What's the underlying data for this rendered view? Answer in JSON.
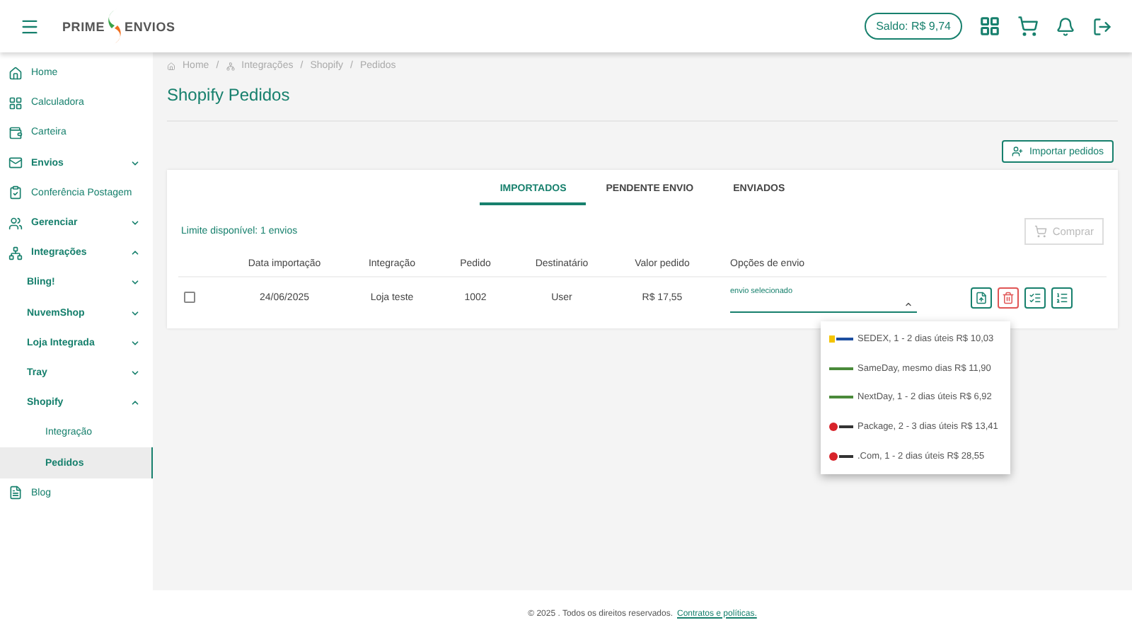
{
  "header": {
    "logo_left": "PRIME",
    "logo_right": "ENVIOS",
    "balance": "Saldo: R$ 9,74"
  },
  "sidebar": {
    "items": [
      {
        "label": "Home",
        "selected": false
      },
      {
        "label": "Calculadora",
        "selected": false
      },
      {
        "label": "Carteira",
        "selected": false
      },
      {
        "label": "Envios",
        "selected": false,
        "expanded": false
      },
      {
        "label": "Conferência Postagem",
        "selected": false
      },
      {
        "label": "Gerenciar",
        "selected": false,
        "expanded": false
      },
      {
        "label": "Integrações",
        "selected": false,
        "expanded": true,
        "children": [
          {
            "label": "Bling!",
            "selected": false,
            "expanded": false
          },
          {
            "label": "NuvemShop",
            "selected": false,
            "expanded": false
          },
          {
            "label": "Loja Integrada",
            "selected": false,
            "expanded": false
          },
          {
            "label": "Tray",
            "selected": false,
            "expanded": false
          },
          {
            "label": "Shopify",
            "selected": false,
            "expanded": true,
            "children": [
              {
                "label": "Integração",
                "selected": false
              },
              {
                "label": "Pedidos",
                "selected": true
              }
            ]
          }
        ]
      },
      {
        "label": "Blog",
        "selected": false
      }
    ]
  },
  "breadcrumb": [
    "Home",
    "Integrações",
    "Shopify",
    "Pedidos"
  ],
  "breadcrumb_separator": "/",
  "page_title": "Shopify Pedidos",
  "import_button": "Importar pedidos",
  "tabs": [
    {
      "label": "IMPORTADOS",
      "selected": true
    },
    {
      "label": "PENDENTE ENVIO",
      "selected": false
    },
    {
      "label": "ENVIADOS",
      "selected": false
    }
  ],
  "limit": "Limite disponível: 1 envios",
  "buy_button": {
    "label": "Comprar",
    "disabled": true
  },
  "table": {
    "columns": [
      "Data importação",
      "Integração",
      "Pedido",
      "Destinatário",
      "Valor pedido",
      "Opções de envio"
    ],
    "rows": [
      {
        "checked": false,
        "cells": [
          "24/06/2025",
          "Loja teste",
          "1002",
          "User",
          "R$ 17,55"
        ],
        "select_label": "envio selecionado",
        "expanded": true
      }
    ]
  },
  "shipping_options": [
    {
      "kind": "correios",
      "label": "SEDEX, 1 - 2 dias úteis R$ 10,03"
    },
    {
      "kind": "loggi",
      "label": "SameDay, mesmo dias R$ 11,90"
    },
    {
      "kind": "loggi",
      "label": "NextDay, 1 - 2 dias úteis R$ 6,92"
    },
    {
      "kind": "jadlog",
      "label": "Package, 2 - 3 dias úteis R$ 13,41"
    },
    {
      "kind": "jadlog",
      "label": ".Com, 1 - 2 dias úteis R$ 28,55"
    }
  ],
  "footer": {
    "text": "© 2025 . Todos os direitos reservados.",
    "link": "Contratos e políticas."
  }
}
